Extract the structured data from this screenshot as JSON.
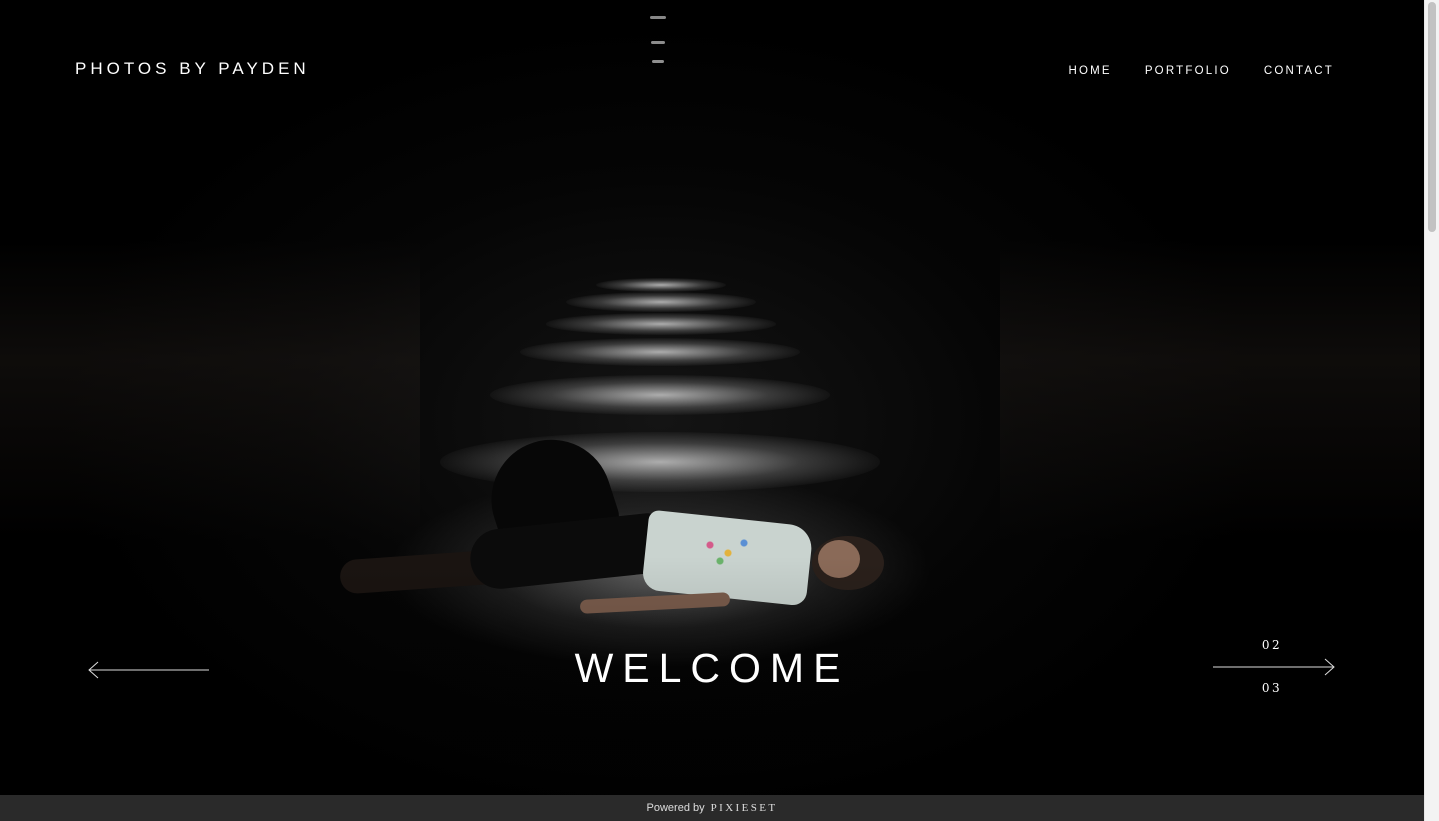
{
  "site": {
    "title": "PHOTOS BY PAYDEN"
  },
  "nav": {
    "items": [
      "HOME",
      "PORTFOLIO",
      "CONTACT"
    ]
  },
  "hero": {
    "heading": "WELCOME",
    "slide_counter": {
      "current": "02",
      "total": "03"
    }
  },
  "icons": {
    "prev": "arrow-left-icon",
    "next": "arrow-right-icon"
  },
  "footer": {
    "powered_by": "Powered by",
    "brand": "PIXIESET"
  },
  "colors": {
    "background": "#000000",
    "text": "#ffffff",
    "footer_bg": "#2a2a2a"
  }
}
